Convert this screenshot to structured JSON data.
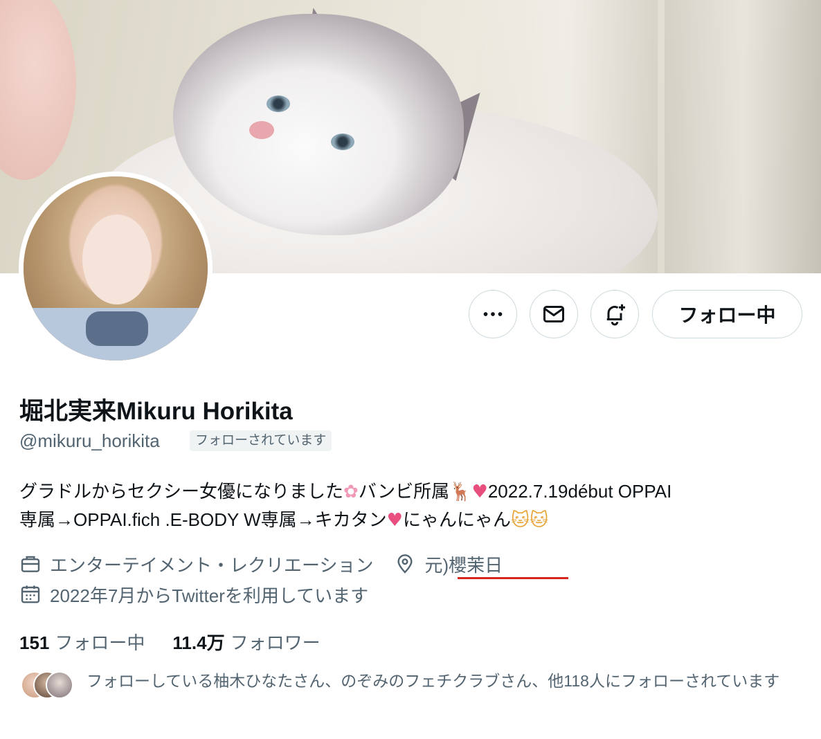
{
  "profile": {
    "display_name": "堀北実来Mikuru Horikita",
    "handle": "@mikuru_horikita",
    "follows_you_badge": "フォローされています",
    "bio_line1_text": "グラドルからセクシー女優になりました",
    "bio_line1_a": "バンビ所属",
    "bio_line1_b": "2022.7.19début OPPAI",
    "bio_line2_text": "専属→OPPAI.fich .E-BODY W専属→キカタン",
    "bio_line2_b": "にゃんにゃん",
    "category": "エンターテイメント・レクリエーション",
    "location": "元)櫻茉日",
    "joined": "2022年7月からTwitterを利用しています",
    "following_count": "151",
    "following_label": "フォロー中",
    "followers_count": "11.4万",
    "followers_label": "フォロワー",
    "mutuals_text": "フォローしている柚木ひなたさん、のぞみのフェチクラブさん、他118人にフォローされています"
  },
  "actions": {
    "more_icon": "more-horizontal-icon",
    "message_icon": "envelope-icon",
    "notify_icon": "bell-plus-icon",
    "follow_label": "フォロー中"
  },
  "colors": {
    "text_primary": "#0f1419",
    "text_secondary": "#536471",
    "border": "#cfd9de",
    "annotation_underline": "#d6261f"
  }
}
